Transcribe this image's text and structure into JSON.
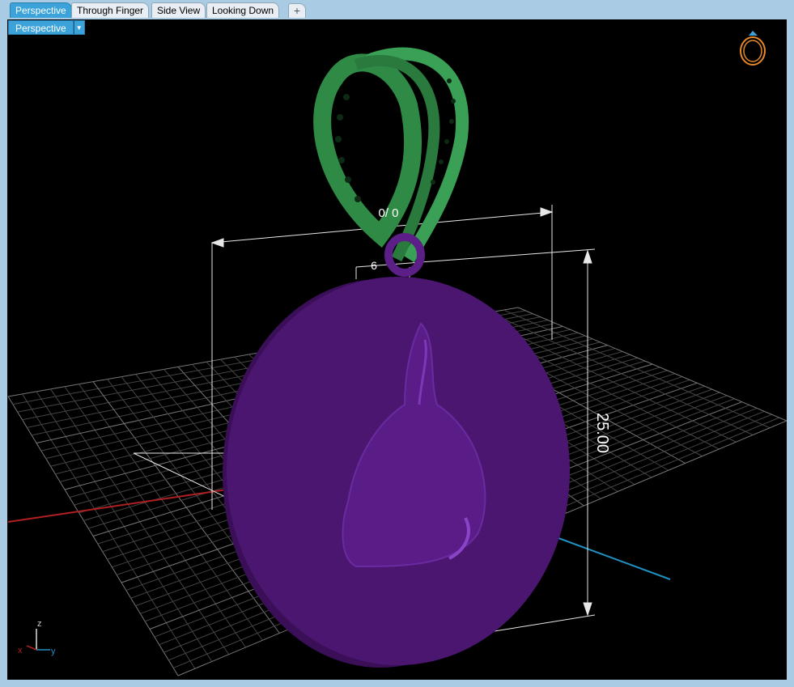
{
  "tabs": [
    {
      "label": "Perspective",
      "active": true
    },
    {
      "label": "Through Finger",
      "active": false
    },
    {
      "label": "Side View",
      "active": false
    },
    {
      "label": "Looking Down",
      "active": false
    }
  ],
  "add_tab_symbol": "+",
  "view_selector": {
    "label": "Perspective",
    "arrow": "▼"
  },
  "dimensions": {
    "height_label": "25.00",
    "width_label": "0/ 0",
    "depth_label": "6"
  },
  "axes": {
    "z": "z",
    "y": "y",
    "x": "x"
  },
  "colors": {
    "pendant": "#4b1670",
    "pendant_edge": "#5c1f87",
    "bail": "#2f8a45",
    "grid": "#5a5a5a",
    "x_axis": "#b02020",
    "y_axis": "#2090c0",
    "dimension_lines": "#e8e8e8",
    "tab_active": "#3ba3d9"
  },
  "icons": {
    "ring_nav": "ring-navigation-icon"
  }
}
